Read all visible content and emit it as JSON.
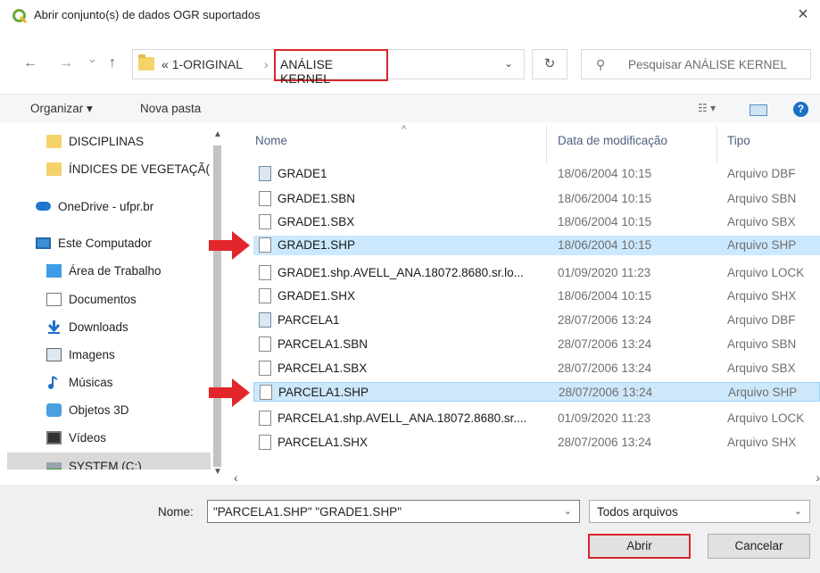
{
  "window": {
    "title": "Abrir conjunto(s) de dados OGR suportados",
    "close": "×"
  },
  "nav": {
    "back": "←",
    "forward": "→",
    "recent": "⌄",
    "up": "↑",
    "breadcrumb_prefix": "«",
    "crumb1": "1-ORIGINAL",
    "separator": "›",
    "crumb2": "ANÁLISE KERNEL",
    "refresh": "↻",
    "search_placeholder": "Pesquisar ANÁLISE KERNEL"
  },
  "toolbar": {
    "organize": "Organizar ▾",
    "new_folder": "Nova pasta",
    "view": "☷ ▾",
    "help": "?"
  },
  "sidebar": {
    "items": [
      {
        "label": "DISCIPLINAS",
        "icon": "folder-icon"
      },
      {
        "label": "ÍNDICES DE VEGETAÇÃ(",
        "icon": "folder-icon"
      },
      {
        "label": "OneDrive - ufpr.br",
        "icon": "cloud-icon"
      },
      {
        "label": "Este Computador",
        "icon": "computer-icon"
      },
      {
        "label": "Área de Trabalho",
        "icon": "desktop-icon"
      },
      {
        "label": "Documentos",
        "icon": "document-icon"
      },
      {
        "label": "Downloads",
        "icon": "download-icon"
      },
      {
        "label": "Imagens",
        "icon": "image-icon"
      },
      {
        "label": "Músicas",
        "icon": "music-icon"
      },
      {
        "label": "Objetos 3D",
        "icon": "cube-icon"
      },
      {
        "label": "Vídeos",
        "icon": "video-icon"
      },
      {
        "label": "SYSTEM (C:)",
        "icon": "drive-icon"
      }
    ]
  },
  "columns": {
    "name": "Nome",
    "date": "Data de modificação",
    "type": "Tipo",
    "sort_indicator": "^"
  },
  "files": [
    {
      "name": "GRADE1",
      "date": "18/06/2004 10:15",
      "type": "Arquivo DBF"
    },
    {
      "name": "GRADE1.SBN",
      "date": "18/06/2004 10:15",
      "type": "Arquivo SBN"
    },
    {
      "name": "GRADE1.SBX",
      "date": "18/06/2004 10:15",
      "type": "Arquivo SBX"
    },
    {
      "name": "GRADE1.SHP",
      "date": "18/06/2004 10:15",
      "type": "Arquivo SHP"
    },
    {
      "name": "GRADE1.shp.AVELL_ANA.18072.8680.sr.lo...",
      "date": "01/09/2020 11:23",
      "type": "Arquivo LOCK"
    },
    {
      "name": "GRADE1.SHX",
      "date": "18/06/2004 10:15",
      "type": "Arquivo SHX"
    },
    {
      "name": "PARCELA1",
      "date": "28/07/2006 13:24",
      "type": "Arquivo DBF"
    },
    {
      "name": "PARCELA1.SBN",
      "date": "28/07/2006 13:24",
      "type": "Arquivo SBN"
    },
    {
      "name": "PARCELA1.SBX",
      "date": "28/07/2006 13:24",
      "type": "Arquivo SBX"
    },
    {
      "name": "PARCELA1.SHP",
      "date": "28/07/2006 13:24",
      "type": "Arquivo SHP"
    },
    {
      "name": "PARCELA1.shp.AVELL_ANA.18072.8680.sr....",
      "date": "01/09/2020 11:23",
      "type": "Arquivo LOCK"
    },
    {
      "name": "PARCELA1.SHX",
      "date": "28/07/2006 13:24",
      "type": "Arquivo SHX"
    }
  ],
  "footer": {
    "name_label": "Nome:",
    "name_value": "\"PARCELA1.SHP\" \"GRADE1.SHP\"",
    "filter": "Todos arquivos",
    "open": "Abrir",
    "cancel": "Cancelar"
  },
  "colors": {
    "highlight": "#cce8ff",
    "annotation_red": "#d8262c",
    "help_blue": "#1a6fc7"
  }
}
